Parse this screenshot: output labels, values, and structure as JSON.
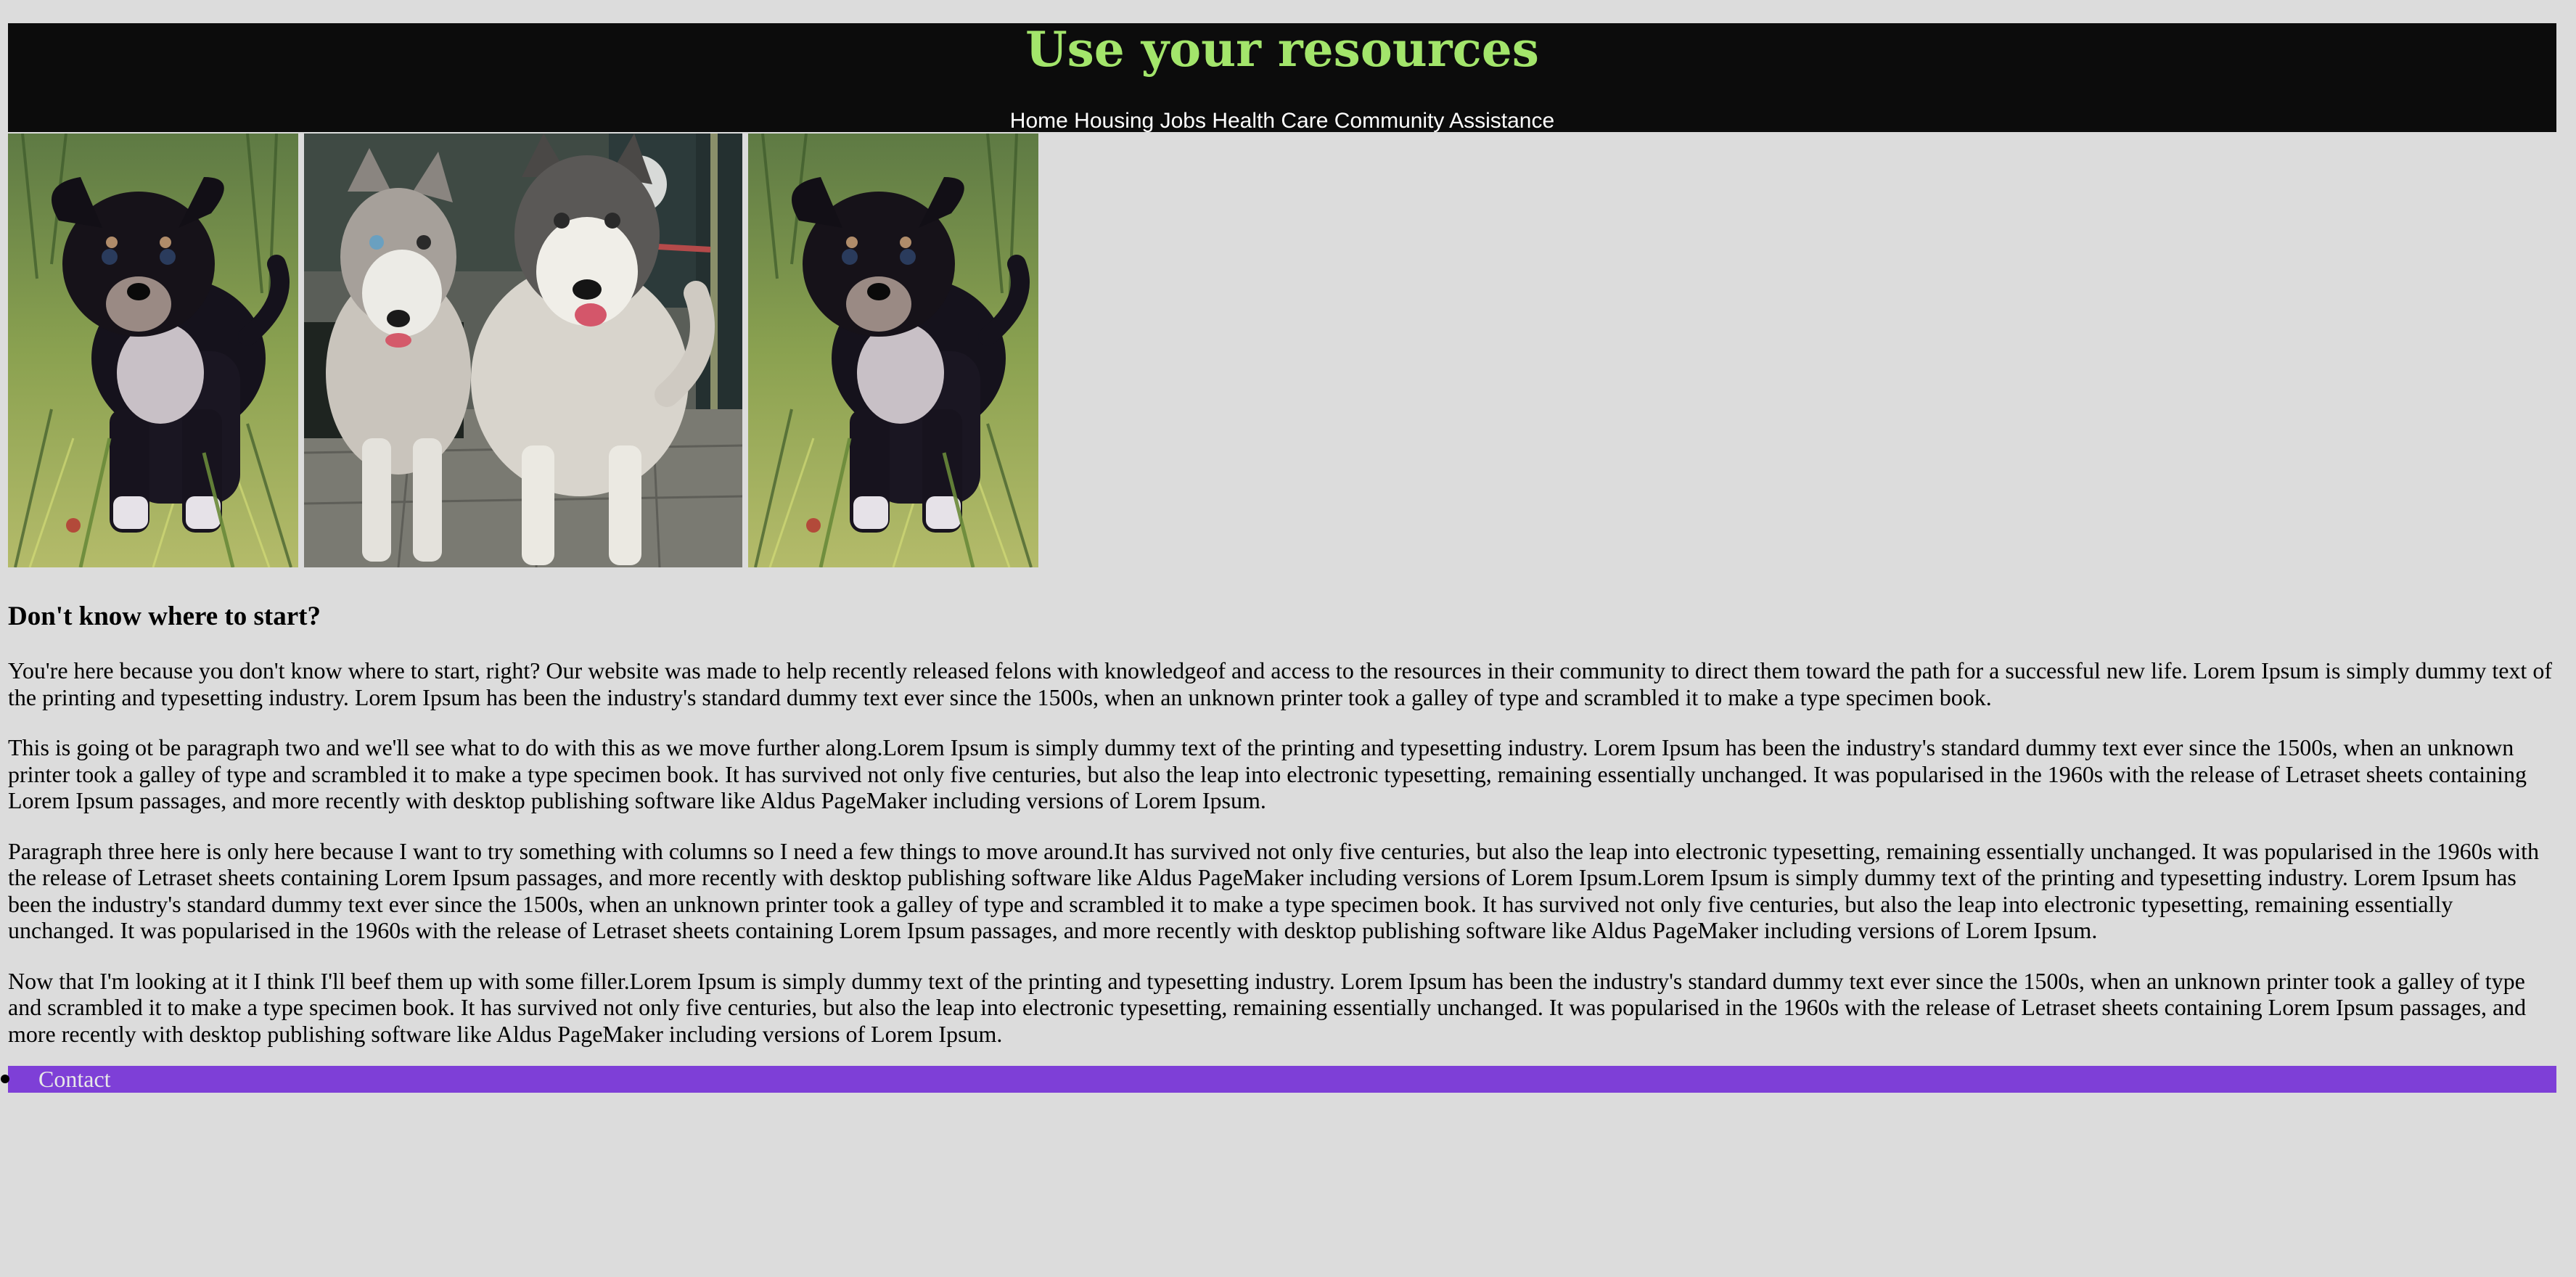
{
  "header": {
    "title": "Use your resources",
    "title_color": "#a3e56b",
    "background": "#0c0c0c"
  },
  "nav": {
    "items": [
      "Home",
      "Housing",
      "Jobs",
      "Health Care",
      "Community Assistance"
    ]
  },
  "photos": [
    {
      "icon": "puppy-photo"
    },
    {
      "icon": "huskies-photo"
    },
    {
      "icon": "puppy-photo"
    }
  ],
  "main": {
    "heading": "Don't know where to start?",
    "paragraphs": [
      "You're here because you don't know where to start, right? Our website was made to help recently released felons with knowledgeof and access to the resources in their community to direct them toward the path for a successful new life. Lorem Ipsum is simply dummy text of the printing and typesetting industry. Lorem Ipsum has been the industry's standard dummy text ever since the 1500s, when an unknown printer took a galley of type and scrambled it to make a type specimen book.",
      "This is going ot be paragraph two and we'll see what to do with this as we move further along.Lorem Ipsum is simply dummy text of the printing and typesetting industry. Lorem Ipsum has been the industry's standard dummy text ever since the 1500s, when an unknown printer took a galley of type and scrambled it to make a type specimen book. It has survived not only five centuries, but also the leap into electronic typesetting, remaining essentially unchanged. It was popularised in the 1960s with the release of Letraset sheets containing Lorem Ipsum passages, and more recently with desktop publishing software like Aldus PageMaker including versions of Lorem Ipsum.",
      "Paragraph three here is only here because I want to try something with columns so I need a few things to move around.It has survived not only five centuries, but also the leap into electronic typesetting, remaining essentially unchanged. It was popularised in the 1960s with the release of Letraset sheets containing Lorem Ipsum passages, and more recently with desktop publishing software like Aldus PageMaker including versions of Lorem Ipsum.Lorem Ipsum is simply dummy text of the printing and typesetting industry. Lorem Ipsum has been the industry's standard dummy text ever since the 1500s, when an unknown printer took a galley of type and scrambled it to make a type specimen book. It has survived not only five centuries, but also the leap into electronic typesetting, remaining essentially unchanged. It was popularised in the 1960s with the release of Letraset sheets containing Lorem Ipsum passages, and more recently with desktop publishing software like Aldus PageMaker including versions of Lorem Ipsum.",
      "Now that I'm looking at it I think I'll beef them up with some filler.Lorem Ipsum is simply dummy text of the printing and typesetting industry. Lorem Ipsum has been the industry's standard dummy text ever since the 1500s, when an unknown printer took a galley of type and scrambled it to make a type specimen book. It has survived not only five centuries, but also the leap into electronic typesetting, remaining essentially unchanged. It was popularised in the 1960s with the release of Letraset sheets containing Lorem Ipsum passages, and more recently with desktop publishing software like Aldus PageMaker including versions of Lorem Ipsum."
    ]
  },
  "footer": {
    "contact_label": "Contact",
    "background": "#7e3fd7"
  }
}
